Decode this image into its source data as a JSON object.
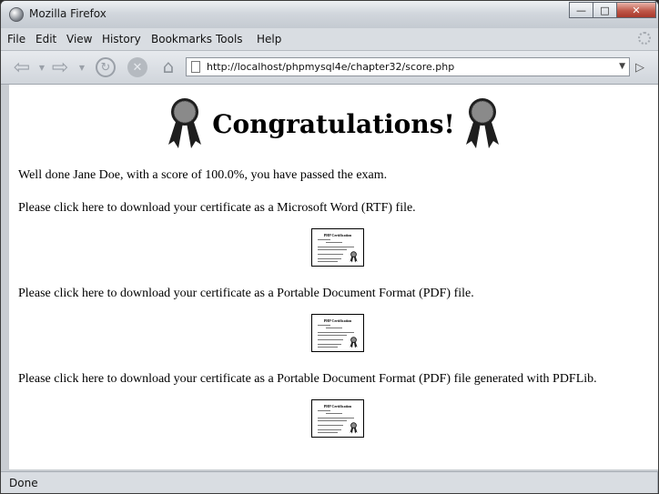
{
  "window": {
    "title": "Mozilla Firefox"
  },
  "menu": [
    {
      "label": "File"
    },
    {
      "label": "Edit"
    },
    {
      "label": "View"
    },
    {
      "label": "History"
    },
    {
      "label": "Bookmarks"
    },
    {
      "label": "Tools"
    },
    {
      "label": "Help"
    }
  ],
  "toolbar": {
    "url": "http://localhost/phpmysql4e/chapter32/score.php",
    "icons": [
      "back-arrow-icon",
      "forward-arrow-icon",
      "reload-icon",
      "stop-icon",
      "home-icon",
      "page-icon",
      "go-arrow-icon"
    ]
  },
  "page": {
    "heading": "Congratulations!",
    "score_message": "Well done Jane Doe, with a score of 100.0%, you have passed the exam.",
    "links": [
      {
        "text": "Please click here to download your certificate as a Microsoft Word (RTF) file."
      },
      {
        "text": "Please click here to download your certificate as a Portable Document Format (PDF) file."
      },
      {
        "text": "Please click here to download your certificate as a Portable Document Format (PDF) file generated with PDFLib."
      }
    ],
    "certificate_title": "PHP Certification"
  },
  "status": {
    "text": "Done"
  },
  "colors": {
    "rosette_dark": "#1e1e1e",
    "rosette_gray": "#8a8a8a",
    "close_red": "#c0594a"
  }
}
